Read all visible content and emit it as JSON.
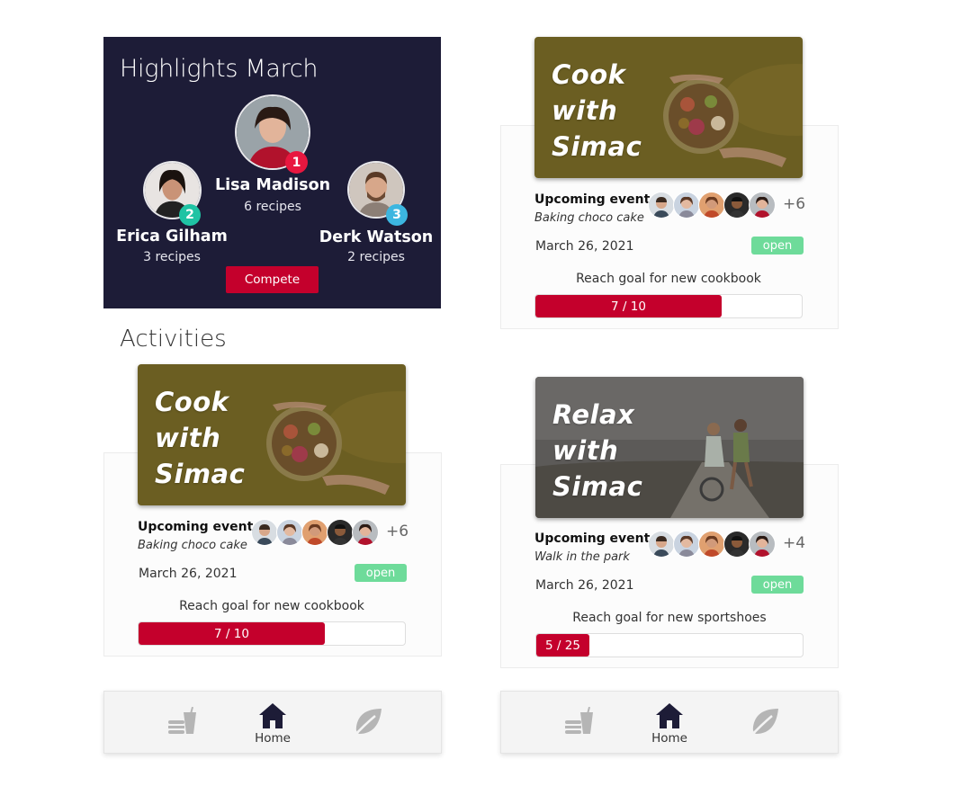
{
  "highlights": {
    "title": "Highlights March",
    "leaders": [
      {
        "rank": "1",
        "name": "Lisa Madison",
        "recipes": "6 recipes",
        "badge_color": "#e8173f"
      },
      {
        "rank": "2",
        "name": "Erica Gilham",
        "recipes": "3 recipes",
        "badge_color": "#1fc3a4"
      },
      {
        "rank": "3",
        "name": "Derk Watson",
        "recipes": "2 recipes",
        "badge_color": "#3cb6e0"
      }
    ],
    "compete_label": "Compete"
  },
  "activities": {
    "title": "Activities"
  },
  "cards": [
    {
      "banner_line1": "Cook",
      "banner_line2": "with",
      "banner_line3": "Simac",
      "banner_image": "salad-bowl-photo",
      "event_label": "Upcoming event",
      "event_name": "Baking choco cake",
      "participants_extra": "+6",
      "date": "March 26, 2021",
      "status": "open",
      "goal_label": "Reach goal for new cookbook",
      "progress_text": "7 / 10",
      "progress_value": 0.7
    },
    {
      "banner_line1": "Cook",
      "banner_line2": "with",
      "banner_line3": "Simac",
      "banner_image": "salad-bowl-photo",
      "event_label": "Upcoming event",
      "event_name": "Baking choco cake",
      "participants_extra": "+6",
      "date": "March 26, 2021",
      "status": "open",
      "goal_label": "Reach goal for new cookbook",
      "progress_text": "7 / 10",
      "progress_value": 0.7
    },
    {
      "banner_line1": "Relax",
      "banner_line2": "with",
      "banner_line3": "Simac",
      "banner_image": "bikes-boardwalk-photo",
      "event_label": "Upcoming event",
      "event_name": "Walk in the park",
      "participants_extra": "+4",
      "date": "March 26, 2021",
      "status": "open",
      "goal_label": "Reach goal for new sportshoes",
      "progress_text": "5 / 25",
      "progress_value": 0.2
    }
  ],
  "nav": {
    "items": [
      {
        "icon": "food-drink-icon",
        "label": ""
      },
      {
        "icon": "home-icon",
        "label": "Home"
      },
      {
        "icon": "leaf-icon",
        "label": ""
      }
    ]
  },
  "colors": {
    "panel": "#1d1c37",
    "accent": "#c4002c",
    "open": "#6edb9a",
    "banner_food": "#6b5e22",
    "banner_relax": "#5c5a58"
  }
}
